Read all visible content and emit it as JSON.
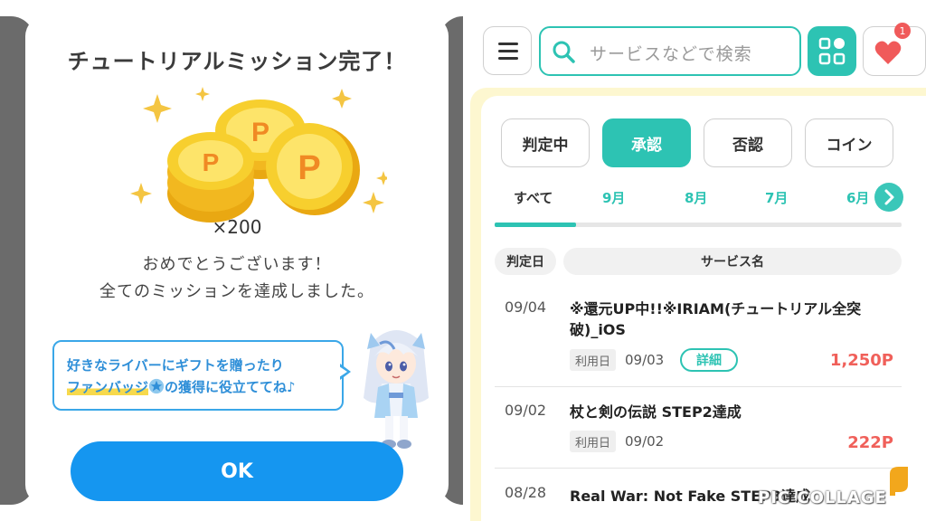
{
  "left": {
    "title": "チュートリアルミッション完了！",
    "coin_count": "×200",
    "congrats_line1": "おめでとうございます！",
    "congrats_line2": "全てのミッションを達成しました。",
    "bubble_line1": "好きなライバーにギフトを贈ったり",
    "bubble_line2_a": "ファンバッジ",
    "bubble_line2_b": "の獲得に役立ててね♪",
    "ok_label": "OK"
  },
  "right": {
    "search_placeholder": "サービスなどで検索",
    "fav_badge": "1",
    "status_tabs": [
      "判定中",
      "承認",
      "否認",
      "コイン"
    ],
    "month_tabs": [
      "すべて",
      "9月",
      "8月",
      "7月",
      "6月"
    ],
    "columns": {
      "date": "判定日",
      "service": "サービス名"
    },
    "use_label": "利用日",
    "detail_label": "詳細",
    "rows": [
      {
        "date": "09/04",
        "name": "※還元UP中!!※IRIAM(チュートリアル全突破)_iOS",
        "use_date": "09/03",
        "points": "1,250P"
      },
      {
        "date": "09/02",
        "name": "杖と剣の伝説 STEP2達成",
        "use_date": "09/02",
        "points": "222P"
      },
      {
        "date": "08/28",
        "name": "Real War: Not Fake STEP3達成"
      }
    ]
  },
  "watermark": "PIC COLLAGE",
  "colors": {
    "accent": "#2dc3b3",
    "ok_blue": "#1596f0",
    "points_red": "#f0605a",
    "bubble_blue": "#3aa7e8"
  },
  "icons": [
    "menu-icon",
    "search-icon",
    "grid-icon",
    "heart-icon",
    "chevron-right-icon",
    "coin-icon",
    "sparkle-icon",
    "star-badge-icon"
  ]
}
